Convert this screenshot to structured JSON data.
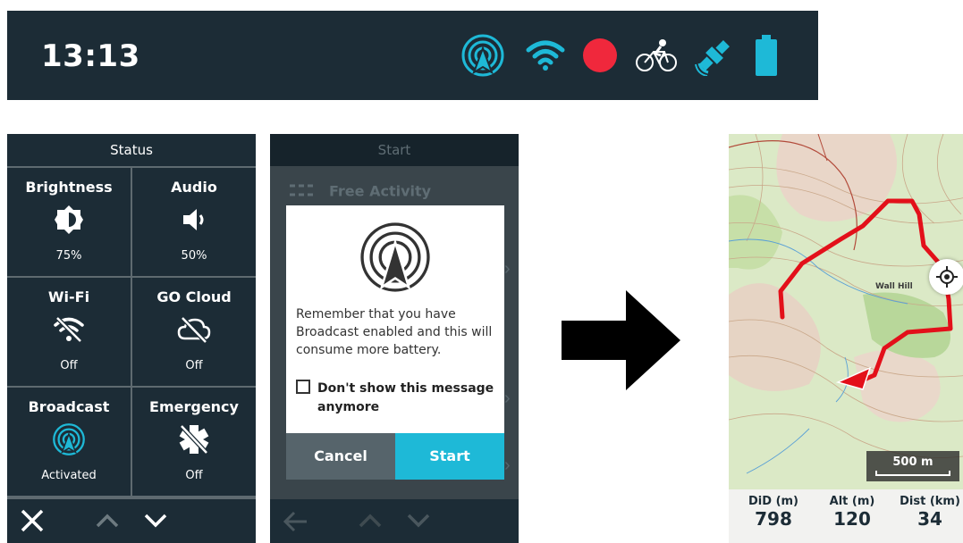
{
  "status_bar": {
    "time": "13:13",
    "icons": [
      "broadcast-icon",
      "wifi-icon",
      "record-icon",
      "bike-sensor-icon",
      "gps-icon",
      "battery-icon"
    ],
    "colors": {
      "background": "#1c2c36",
      "accent": "#1eb9d7",
      "record": "#f0283c"
    }
  },
  "status_panel": {
    "title": "Status",
    "tiles": [
      {
        "label": "Brightness",
        "value": "75%",
        "icon": "brightness-icon"
      },
      {
        "label": "Audio",
        "value": "50%",
        "icon": "speaker-icon"
      },
      {
        "label": "Wi-Fi",
        "value": "Off",
        "icon": "wifi-off-icon"
      },
      {
        "label": "GO Cloud",
        "value": "Off",
        "icon": "cloud-off-icon"
      },
      {
        "label": "Broadcast",
        "value": "Activated",
        "icon": "broadcast-icon"
      },
      {
        "label": "Emergency",
        "value": "Off",
        "icon": "emergency-off-icon"
      }
    ],
    "nav": [
      "close-icon",
      "chevron-up-icon",
      "chevron-down-icon"
    ]
  },
  "start_panel": {
    "title": "Start",
    "background_item": "Free Activity",
    "dialog": {
      "message": "Remember that you have Broadcast enabled and this will consume more battery.",
      "checkbox_label": "Don't show this message anymore",
      "cancel_label": "Cancel",
      "start_label": "Start"
    },
    "nav": [
      "back-arrow-icon",
      "chevron-up-icon",
      "chevron-down-icon"
    ]
  },
  "map_panel": {
    "scale_label": "500 m",
    "place_labels": [
      "Wall Hill"
    ],
    "stats": [
      {
        "label": "DiD (m)",
        "value": "798"
      },
      {
        "label": "Alt (m)",
        "value": "120"
      },
      {
        "label": "Dist (km)",
        "value": "34"
      }
    ],
    "colors": {
      "track": "#e3101a",
      "land": "#d9e8c0"
    }
  }
}
